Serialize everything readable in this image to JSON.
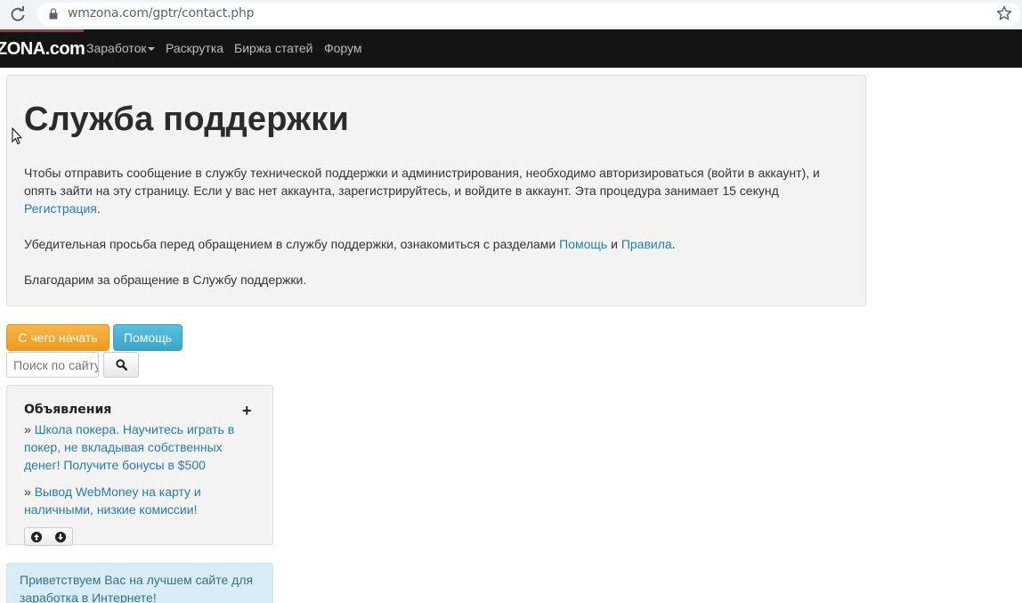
{
  "browser": {
    "url": "wmzona.com/gptr/contact.php"
  },
  "navbar": {
    "brand": "ZONA.com",
    "items": [
      {
        "label": "Заработок"
      },
      {
        "label": "Раскрутка"
      },
      {
        "label": "Биржа статей"
      },
      {
        "label": "Форум"
      }
    ]
  },
  "main": {
    "title": "Служба поддержки",
    "para1_line1": "Чтобы отправить сообщение в службу технической поддержки и администрирования, необходимо авторизироваться (войти в аккаунт), и",
    "para1_line2": "опять зайти на эту страницу. Если у вас нет аккаунта, зарегистрируйтесь, и войдите в аккаунт. Эта процедура занимает 15 секунд",
    "register_link": "Регистрация",
    "para1_end": ".",
    "para2_start": "Убедительная просьба перед обращением в службу поддержки, ознакомиться с разделами ",
    "help_link": "Помощь",
    "para2_and": " и ",
    "rules_link": "Правила",
    "para2_end": ".",
    "para3": "Благодарим за обращение в Службу поддержки."
  },
  "sidebar": {
    "start_button": "С чего начать",
    "help_button": "Помощь",
    "search_placeholder": "Поиск по сайту",
    "ads_title": "Объявления",
    "ads_plus": "+",
    "ads": [
      {
        "bullet": "» ",
        "text": "Школа покера. Научитесь играть в покер, не вкладывая собственных денег! Получите бонусы в $500"
      },
      {
        "bullet": "» ",
        "text": "Вывод WebMoney на карту и наличными, низкие комиссии!"
      }
    ],
    "welcome": "Приветствуем Вас на лучшем сайте для заработка в Интернете!"
  },
  "colors": {
    "navbar_bg": "#141414",
    "link": "#2a7ab0",
    "start_button": "#ee9b1e",
    "help_button": "#3aa6c8",
    "welcome_bg": "#d9edf7"
  }
}
